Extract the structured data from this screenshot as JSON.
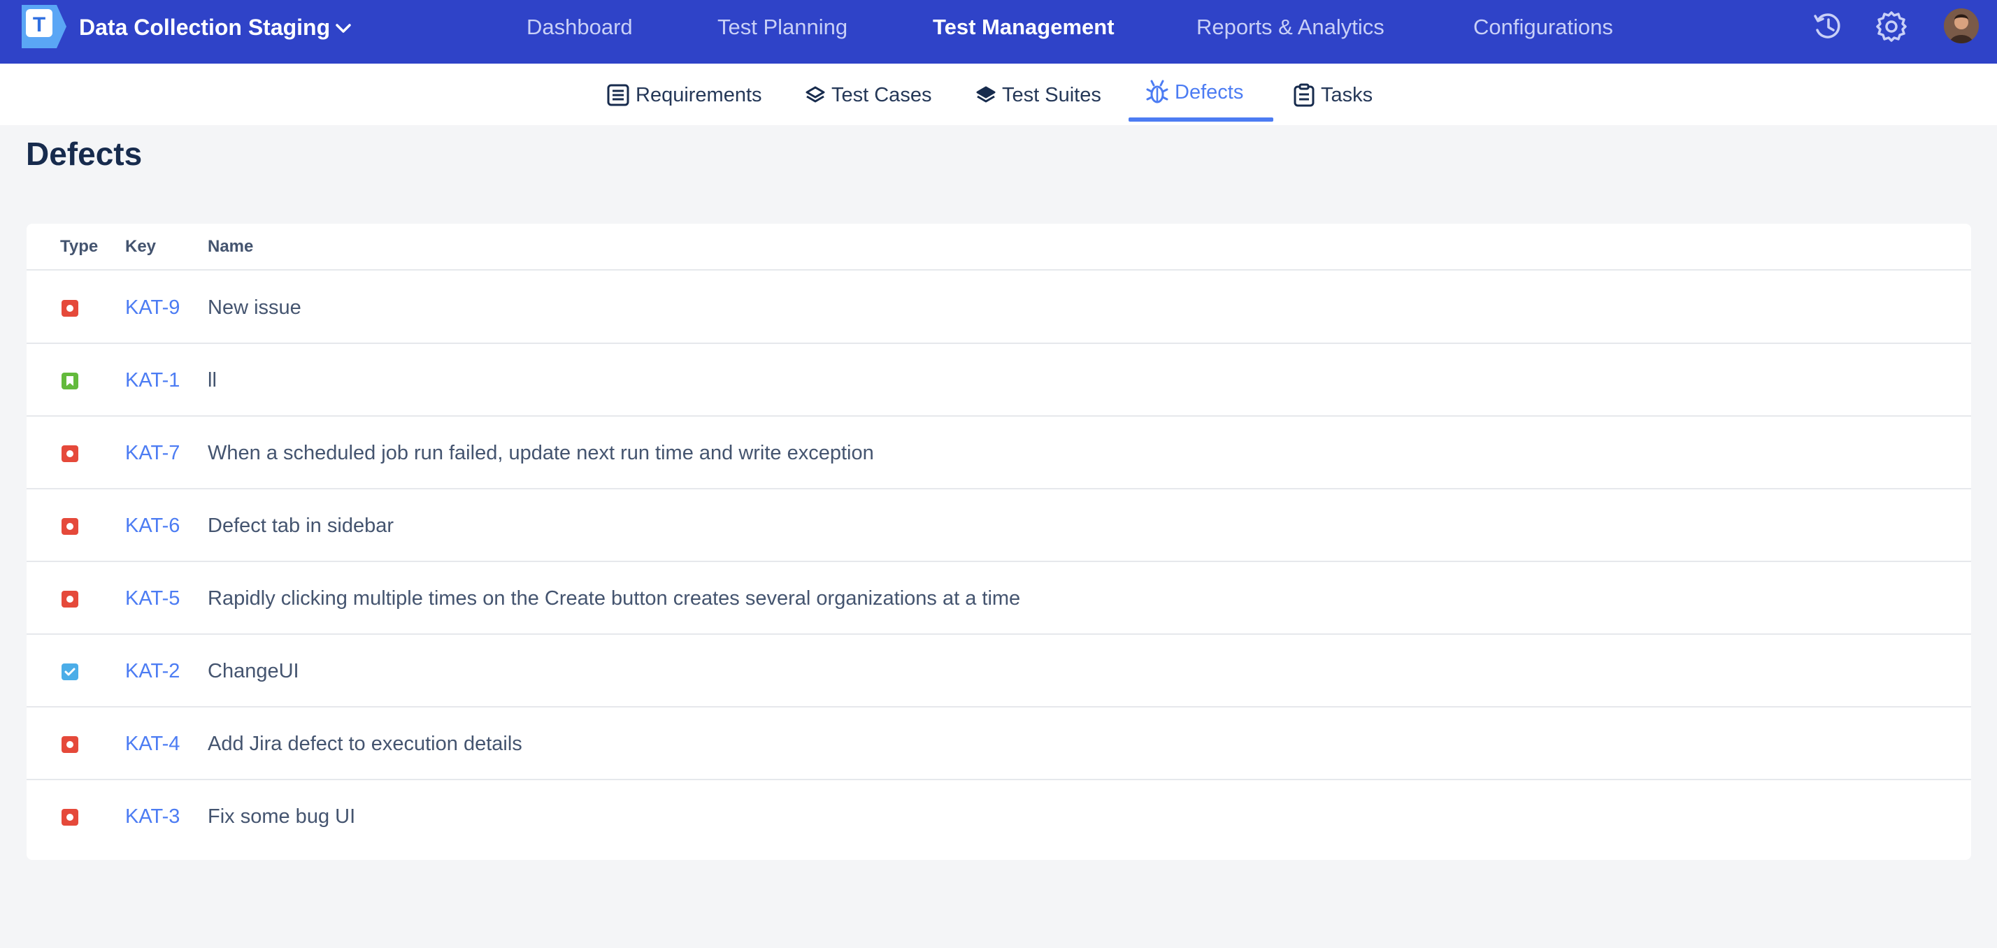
{
  "app": {
    "project_name": "Data Collection Staging"
  },
  "top_nav": [
    {
      "label": "Dashboard",
      "active": false
    },
    {
      "label": "Test Planning",
      "active": false
    },
    {
      "label": "Test Management",
      "active": true
    },
    {
      "label": "Reports & Analytics",
      "active": false
    },
    {
      "label": "Configurations",
      "active": false
    }
  ],
  "top_icons": [
    "history-icon",
    "gear-icon",
    "user-avatar"
  ],
  "sub_nav": [
    {
      "label": "Requirements",
      "icon": "list-icon",
      "active": false
    },
    {
      "label": "Test Cases",
      "icon": "layers-icon",
      "active": false
    },
    {
      "label": "Test Suites",
      "icon": "layers-icon",
      "active": false
    },
    {
      "label": "Defects",
      "icon": "bug-icon",
      "active": true
    },
    {
      "label": "Tasks",
      "icon": "clipboard-icon",
      "active": false
    }
  ],
  "page": {
    "title": "Defects"
  },
  "table": {
    "columns": [
      "Type",
      "Key",
      "Name"
    ],
    "rows": [
      {
        "type": "bug",
        "key": "KAT-9",
        "name": "New issue"
      },
      {
        "type": "story",
        "key": "KAT-1",
        "name": "ll"
      },
      {
        "type": "bug",
        "key": "KAT-7",
        "name": "When a scheduled job run failed, update next run time and write exception"
      },
      {
        "type": "bug",
        "key": "KAT-6",
        "name": "Defect tab in sidebar"
      },
      {
        "type": "bug",
        "key": "KAT-5",
        "name": "Rapidly clicking multiple times on the Create button creates several organizations at a time"
      },
      {
        "type": "task",
        "key": "KAT-2",
        "name": "ChangeUI"
      },
      {
        "type": "bug",
        "key": "KAT-4",
        "name": "Add Jira defect to execution details"
      },
      {
        "type": "bug",
        "key": "KAT-3",
        "name": "Fix some bug UI"
      }
    ]
  },
  "colors": {
    "topbar": "#2f43c8",
    "accent": "#4c7cf3",
    "bug": "#e5493a",
    "story": "#63ba3c",
    "task": "#4bade8"
  }
}
